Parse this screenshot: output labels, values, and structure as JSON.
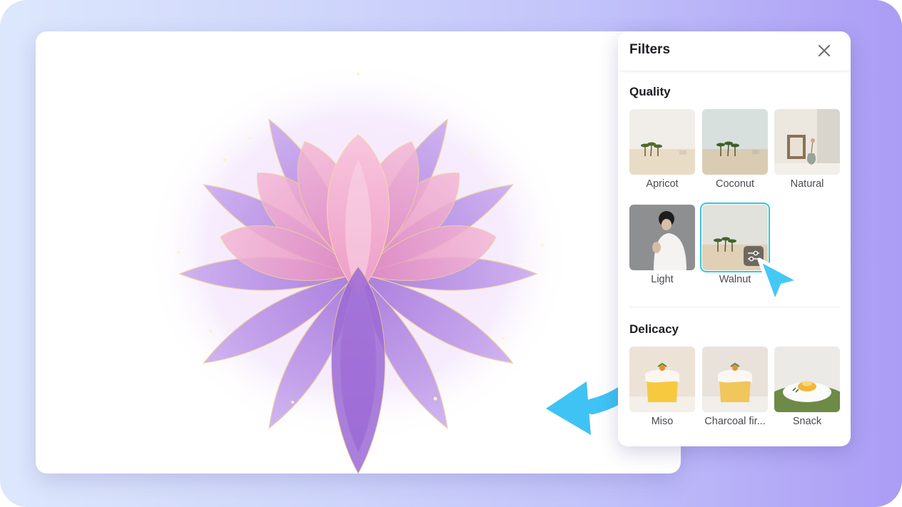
{
  "panel": {
    "title": "Filters",
    "close_icon": "close-icon"
  },
  "sections": [
    {
      "title": "Quality",
      "items": [
        {
          "label": "Apricot",
          "thumb": "desert-palms-warm"
        },
        {
          "label": "Coconut",
          "thumb": "desert-palms-cool"
        },
        {
          "label": "Natural",
          "thumb": "frame-vase-still-life"
        },
        {
          "label": "Light",
          "thumb": "woman-white-blouse"
        },
        {
          "label": "Walnut",
          "thumb": "desert-palms-muted",
          "selected": true,
          "badge_icon": "sliders-icon"
        }
      ]
    },
    {
      "title": "Delicacy",
      "items": [
        {
          "label": "Miso",
          "thumb": "cake-on-plate"
        },
        {
          "label": "Charcoal fir...",
          "thumb": "cake-on-plate-light"
        },
        {
          "label": "Snack",
          "thumb": "dessert-plate-green"
        }
      ]
    }
  ],
  "colors": {
    "accent_selection": "#2ec9dc",
    "cursor": "#46c8f5",
    "arrow": "#3fc3f4"
  },
  "canvas": {
    "image": "watercolor-lotus-flower"
  }
}
